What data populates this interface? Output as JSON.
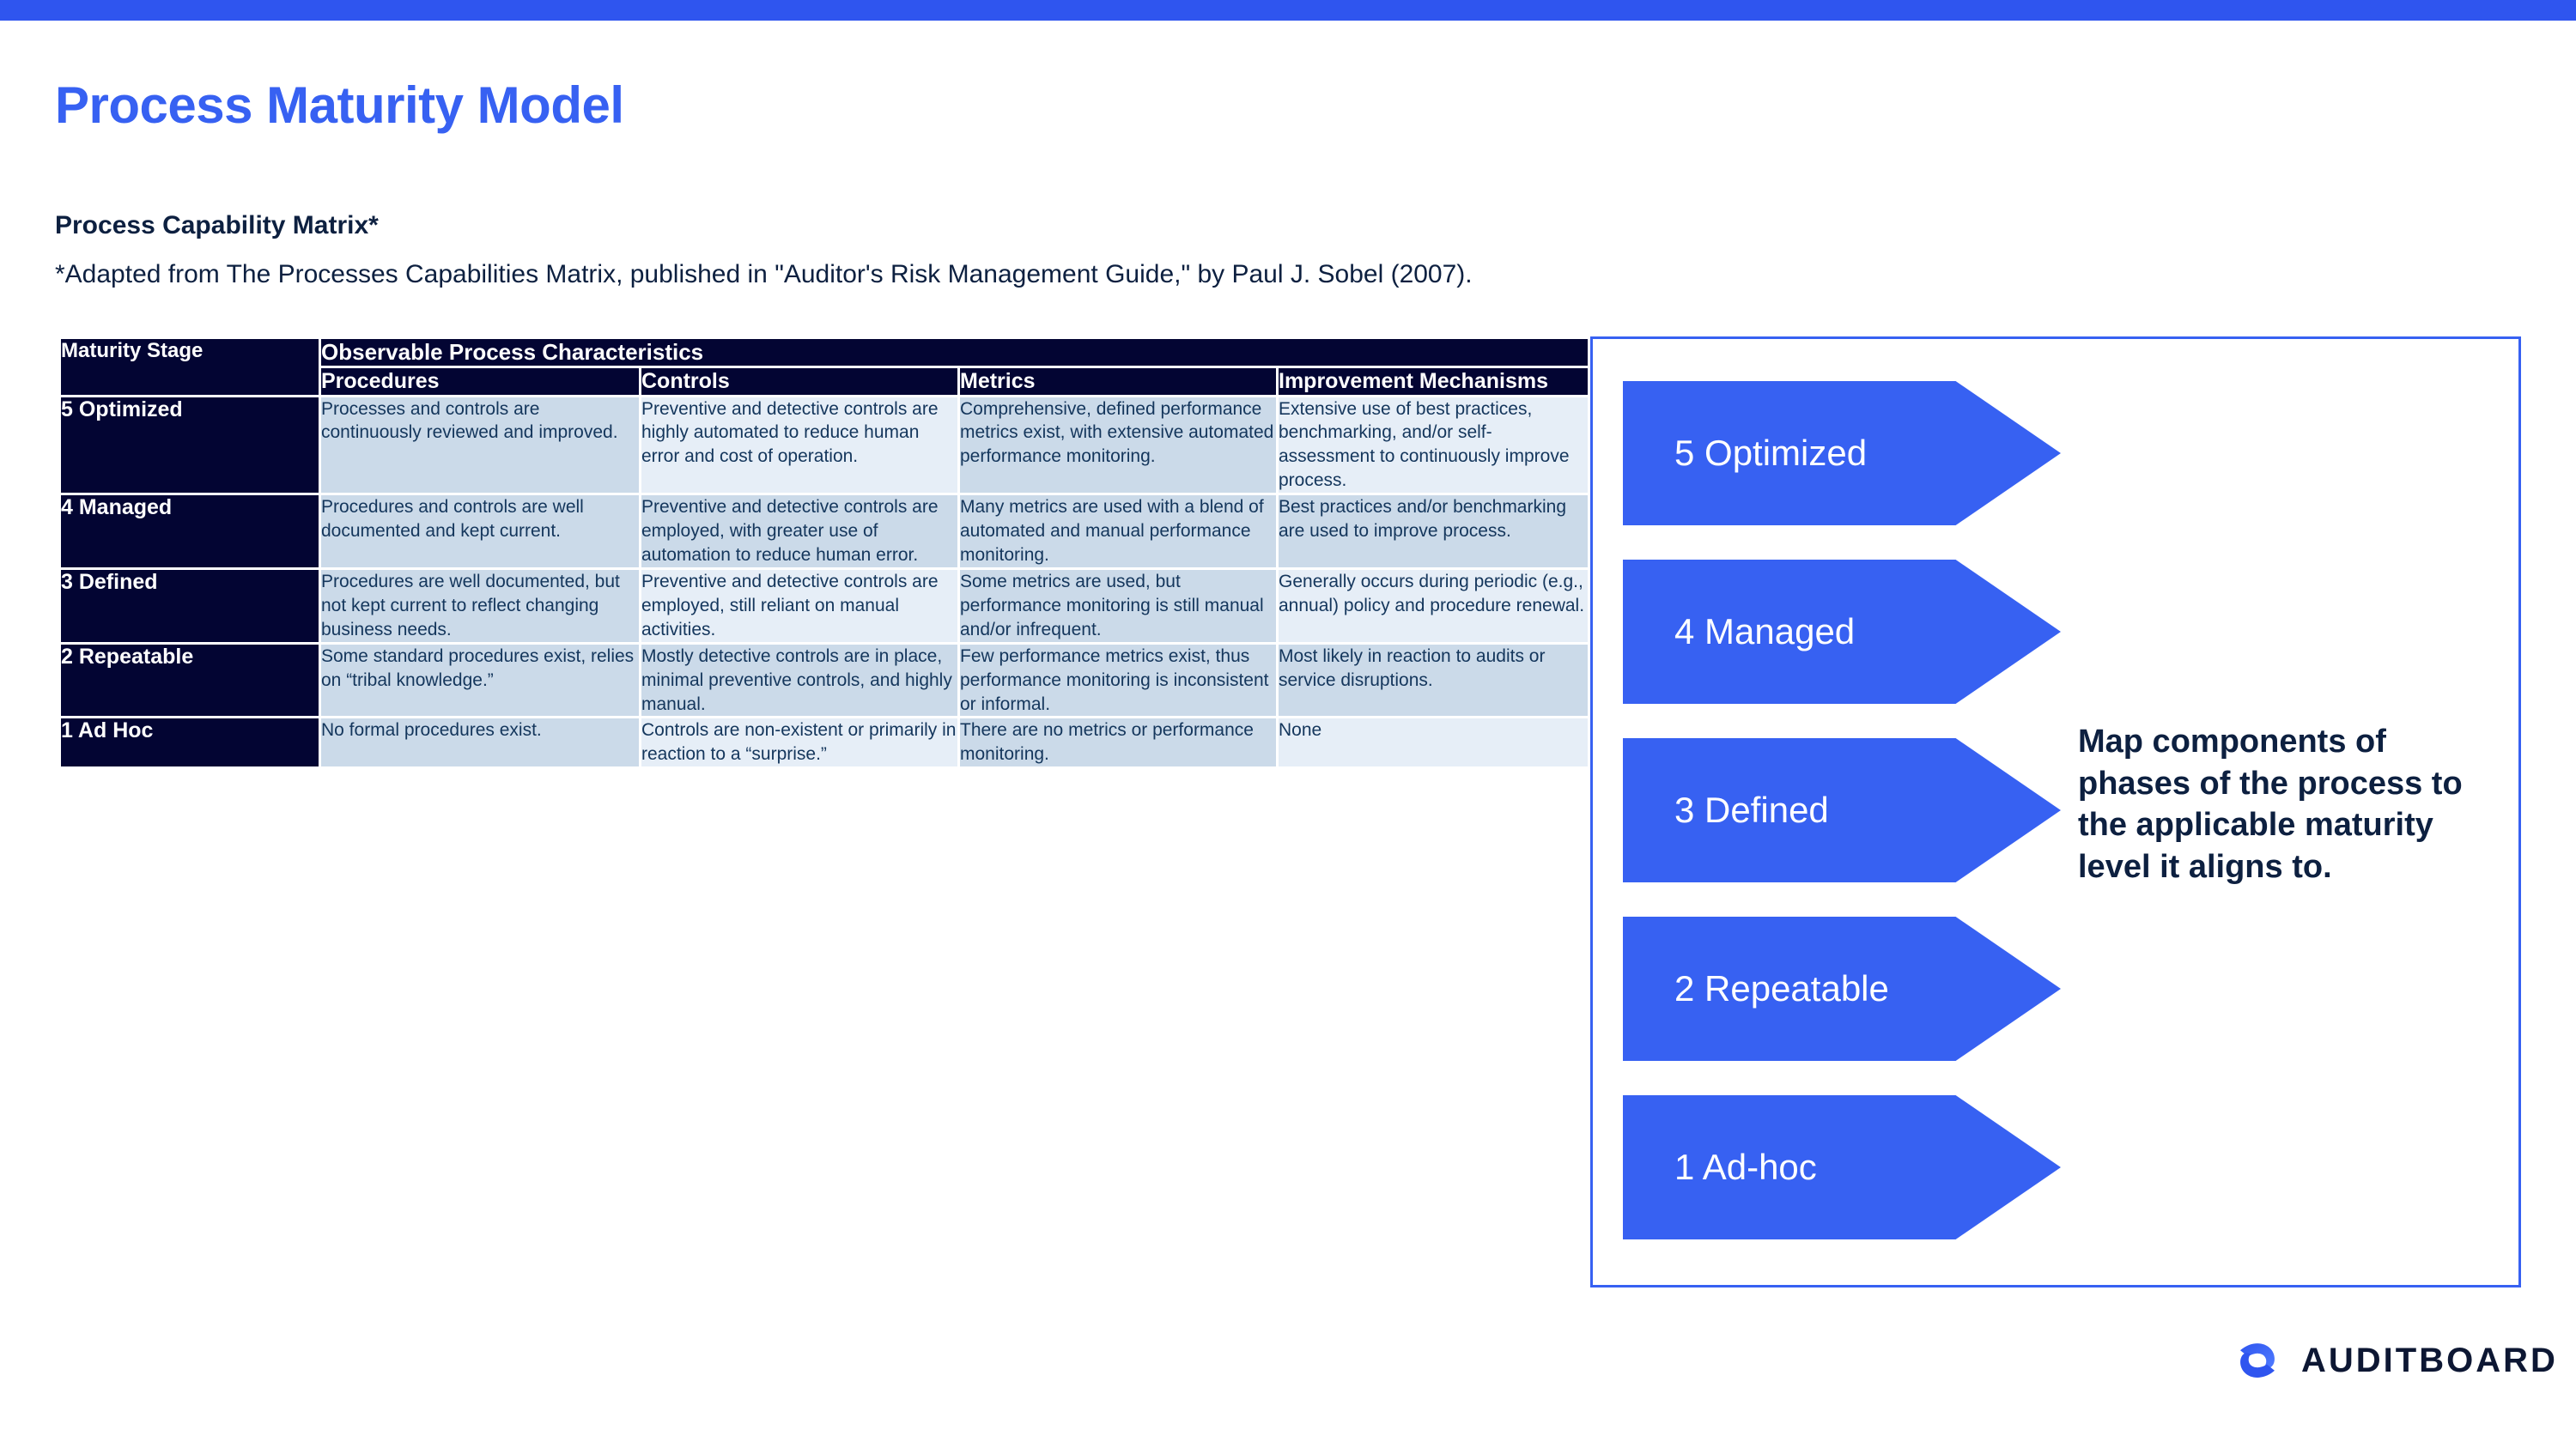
{
  "accent_color": "#3761f2",
  "dark_color": "#030533",
  "header": {
    "title": "Process Maturity Model",
    "subtitle": "Process Capability Matrix*",
    "source_note": "*Adapted from The Processes Capabilities Matrix, published in \"Auditor's Risk Management Guide,\" by Paul J. Sobel (2007)."
  },
  "matrix": {
    "stage_header": "Maturity Stage",
    "group_header": "Observable Process Characteristics",
    "columns": [
      "Procedures",
      "Controls",
      "Metrics",
      "Improvement\nMechanisms"
    ],
    "column_labels": {
      "procedures": "Procedures",
      "controls": "Controls",
      "metrics": "Metrics",
      "improvement": "Improvement Mechanisms"
    },
    "rows": [
      {
        "stage": "5 Optimized",
        "procedures": "Processes and controls are continuously reviewed and improved.",
        "controls": "Preventive and detective controls are highly automated to reduce human error and cost of operation.",
        "metrics": "Comprehensive, defined performance metrics exist, with extensive automated performance monitoring.",
        "improvement": "Extensive use of best practices, benchmarking, and/or self-assessment to continuously improve process."
      },
      {
        "stage": "4 Managed",
        "procedures": "Procedures and controls are well documented and kept current.",
        "controls": "Preventive and detective controls are employed, with greater use of automation to reduce human error.",
        "metrics": "Many metrics are used with a blend of automated and manual performance monitoring.",
        "improvement": "Best practices and/or benchmarking are used to improve process."
      },
      {
        "stage": "3 Defined",
        "procedures": "Procedures are well documented, but not kept current to reflect changing business needs.",
        "controls": "Preventive and detective controls are employed, still reliant on manual activities.",
        "metrics": "Some metrics are used, but performance monitoring is still manual and/or infrequent.",
        "improvement": "Generally occurs during periodic (e.g., annual) policy and procedure renewal."
      },
      {
        "stage": "2 Repeatable",
        "procedures": "Some standard procedures exist, relies on “tribal knowledge.”",
        "controls": "Mostly detective controls are in place, minimal preventive controls, and highly manual.",
        "metrics": "Few performance metrics exist, thus performance monitoring is inconsistent or informal.",
        "improvement": "Most likely in reaction to audits or service disruptions."
      },
      {
        "stage": "1 Ad Hoc",
        "procedures": "No formal procedures exist.",
        "controls": "Controls are non-existent or primarily in reaction to a “surprise.”",
        "metrics": "There are no metrics or performance monitoring.",
        "improvement": "None"
      }
    ]
  },
  "right_panel": {
    "chevrons": [
      {
        "label": "5 Optimized"
      },
      {
        "label": "4 Managed"
      },
      {
        "label": "3 Defined"
      },
      {
        "label": "2 Repeatable"
      },
      {
        "label": "1 Ad-hoc"
      }
    ],
    "note": "Map components of phases of the process to the applicable maturity level it aligns to."
  },
  "footer": {
    "logo_text": "AUDITBOARD"
  }
}
